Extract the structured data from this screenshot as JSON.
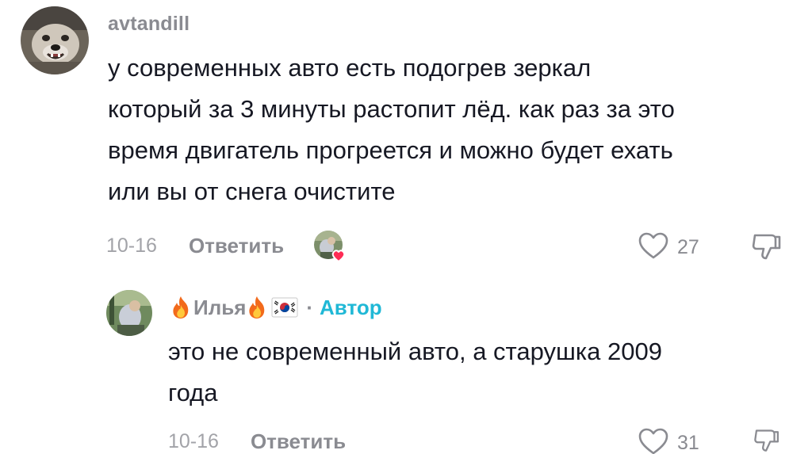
{
  "comments": [
    {
      "username": "avtandill",
      "text_lines": [
        "у современных авто есть подогрев зеркал",
        "который за 3 минуты растопит лёд. как раз за это",
        "время двигатель прогреется и можно будет ехать",
        "или вы от снега очистите"
      ],
      "date": "10-16",
      "reply_label": "Ответить",
      "likes": "27"
    },
    {
      "username": "Илья",
      "separator": "·",
      "author_badge": "Автор",
      "text_lines": [
        "это не современный авто, а старушка 2009",
        "года"
      ],
      "date": "10-16",
      "reply_label": "Ответить",
      "likes": "31"
    }
  ],
  "colors": {
    "text": "#161823",
    "secondary": "#8a8b91",
    "author_accent": "#20b8d6",
    "liked_heart": "#fe2c55"
  }
}
